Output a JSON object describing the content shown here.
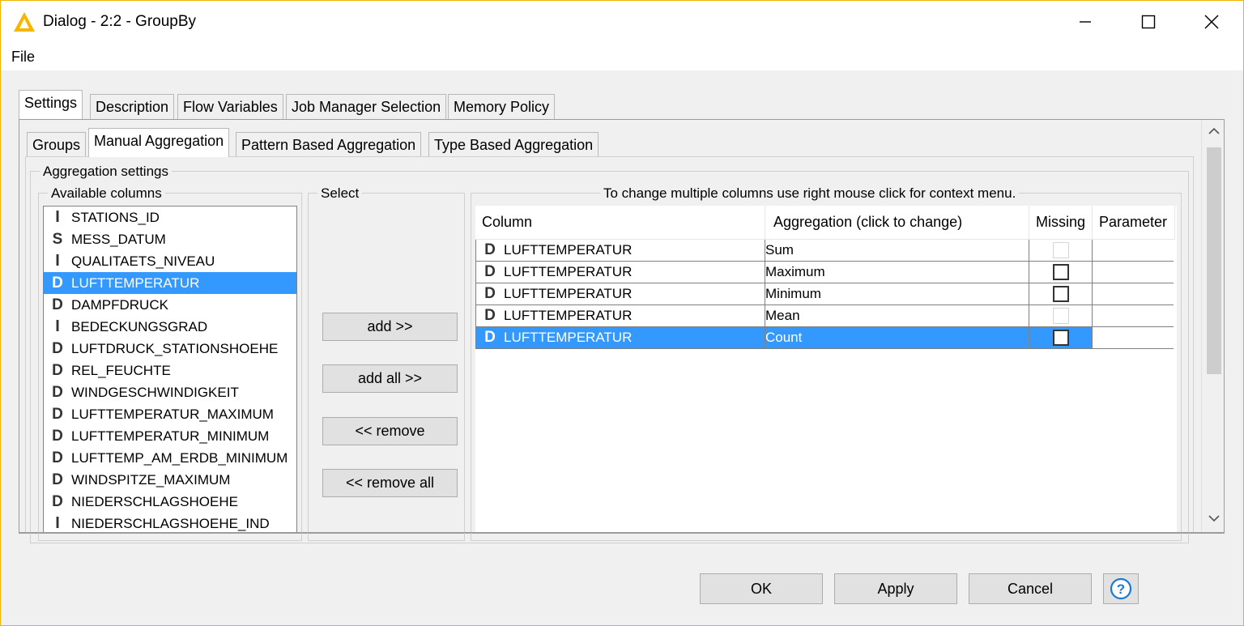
{
  "window": {
    "title": "Dialog - 2:2 - GroupBy",
    "menu_file": "File"
  },
  "main_tabs": [
    {
      "label": "Settings"
    },
    {
      "label": "Description"
    },
    {
      "label": "Flow Variables"
    },
    {
      "label": "Job Manager Selection"
    },
    {
      "label": "Memory Policy"
    }
  ],
  "sub_tabs": [
    {
      "label": "Groups"
    },
    {
      "label": "Manual Aggregation"
    },
    {
      "label": "Pattern Based Aggregation"
    },
    {
      "label": "Type Based Aggregation"
    }
  ],
  "aggregation_settings": {
    "label": "Aggregation settings",
    "available_label": "Available columns",
    "select_label": "Select",
    "hint": "To change multiple columns use right mouse click for context menu."
  },
  "available_columns": [
    {
      "type": "I",
      "name": "STATIONS_ID"
    },
    {
      "type": "S",
      "name": "MESS_DATUM"
    },
    {
      "type": "I",
      "name": "QUALITAETS_NIVEAU"
    },
    {
      "type": "D",
      "name": "LUFTTEMPERATUR",
      "selected": true
    },
    {
      "type": "D",
      "name": "DAMPFDRUCK"
    },
    {
      "type": "I",
      "name": "BEDECKUNGSGRAD"
    },
    {
      "type": "D",
      "name": "LUFTDRUCK_STATIONSHOEHE"
    },
    {
      "type": "D",
      "name": "REL_FEUCHTE"
    },
    {
      "type": "D",
      "name": "WINDGESCHWINDIGKEIT"
    },
    {
      "type": "D",
      "name": "LUFTTEMPERATUR_MAXIMUM"
    },
    {
      "type": "D",
      "name": "LUFTTEMPERATUR_MINIMUM"
    },
    {
      "type": "D",
      "name": "LUFTTEMP_AM_ERDB_MINIMUM"
    },
    {
      "type": "D",
      "name": "WINDSPITZE_MAXIMUM"
    },
    {
      "type": "D",
      "name": "NIEDERSCHLAGSHOEHE"
    },
    {
      "type": "I",
      "name": "NIEDERSCHLAGSHOEHE_IND"
    }
  ],
  "buttons": {
    "add": "add >>",
    "add_all": "add all >>",
    "remove": "<< remove",
    "remove_all": "<< remove all"
  },
  "table": {
    "headers": [
      "Column",
      "Aggregation (click to change)",
      "Missing",
      "Parameter"
    ],
    "rows": [
      {
        "type": "D",
        "column": "LUFTTEMPERATUR",
        "aggregation": "Sum",
        "missing_enabled": false,
        "selected": false
      },
      {
        "type": "D",
        "column": "LUFTTEMPERATUR",
        "aggregation": "Maximum",
        "missing_enabled": true,
        "selected": false
      },
      {
        "type": "D",
        "column": "LUFTTEMPERATUR",
        "aggregation": "Minimum",
        "missing_enabled": true,
        "selected": false
      },
      {
        "type": "D",
        "column": "LUFTTEMPERATUR",
        "aggregation": "Mean",
        "missing_enabled": false,
        "selected": false
      },
      {
        "type": "D",
        "column": "LUFTTEMPERATUR",
        "aggregation": "Count",
        "missing_enabled": true,
        "selected": true
      }
    ]
  },
  "footer": {
    "ok": "OK",
    "apply": "Apply",
    "cancel": "Cancel"
  },
  "colors": {
    "selection": "#3399ff",
    "window_border": "#f0b400",
    "help_icon": "#1a7ad8"
  }
}
